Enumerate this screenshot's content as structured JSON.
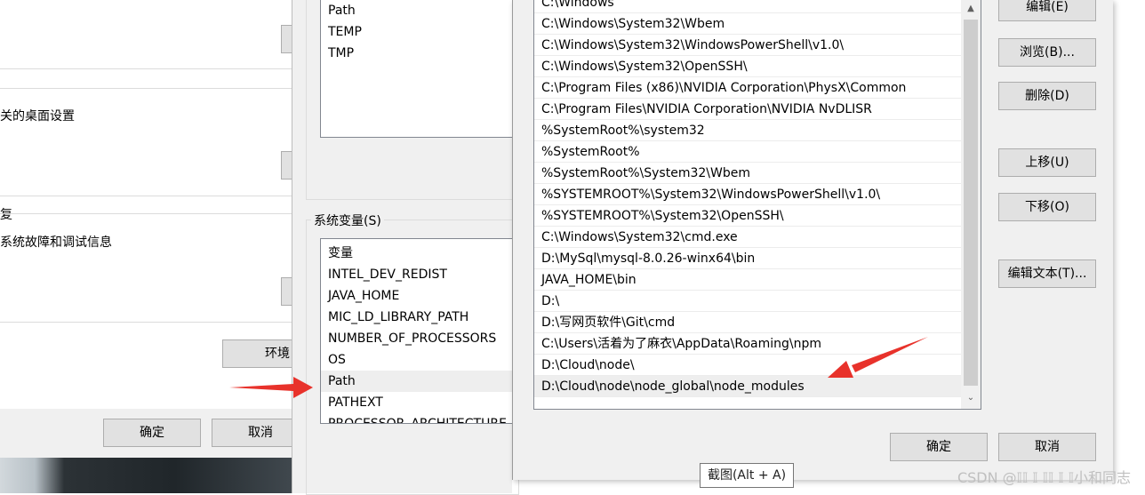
{
  "system_properties": {
    "related_desktop_settings": "关的桌面设置",
    "startup_recovery_heading": "复",
    "startup_recovery_desc": "系统故障和调试信息",
    "env_vars_button": "环境",
    "ok_button": "确定",
    "cancel_button": "取消"
  },
  "environment_variables": {
    "user_vars": [
      "Path",
      "TEMP",
      "TMP"
    ],
    "system_vars_label": "系统变量(S)",
    "system_vars_header": "变量",
    "system_vars": [
      "INTEL_DEV_REDIST",
      "JAVA_HOME",
      "MIC_LD_LIBRARY_PATH",
      "NUMBER_OF_PROCESSORS",
      "OS",
      "Path",
      "PATHEXT",
      "PROCESSOR_ARCHITECTURE"
    ],
    "selected_system_var": "Path"
  },
  "edit_dialog": {
    "path_entries": [
      "C:\\Windows",
      "C:\\Windows\\System32\\Wbem",
      "C:\\Windows\\System32\\WindowsPowerShell\\v1.0\\",
      "C:\\Windows\\System32\\OpenSSH\\",
      "C:\\Program Files (x86)\\NVIDIA Corporation\\PhysX\\Common",
      "C:\\Program Files\\NVIDIA Corporation\\NVIDIA NvDLISR",
      "%SystemRoot%\\system32",
      "%SystemRoot%",
      "%SystemRoot%\\System32\\Wbem",
      "%SYSTEMROOT%\\System32\\WindowsPowerShell\\v1.0\\",
      "%SYSTEMROOT%\\System32\\OpenSSH\\",
      "C:\\Windows\\System32\\cmd.exe",
      "D:\\MySql\\mysql-8.0.26-winx64\\bin",
      "JAVA_HOME\\bin",
      "D:\\",
      "D:\\写网页软件\\Git\\cmd",
      "C:\\Users\\活着为了麻衣\\AppData\\Roaming\\npm",
      "D:\\Cloud\\node\\",
      "D:\\Cloud\\node\\node_global\\node_modules"
    ],
    "selected_entry": "D:\\Cloud\\node\\node_global\\node_modules",
    "buttons": {
      "edit": "编辑(E)",
      "browse": "浏览(B)...",
      "delete": "删除(D)",
      "move_up": "上移(U)",
      "move_down": "下移(O)",
      "edit_text": "编辑文本(T)...",
      "ok": "确定",
      "cancel": "取消"
    }
  },
  "tooltip": "截图(Alt + A)",
  "watermark": "CSDN @𝕀𝕀 𝕀 𝕀𝕀 𝕀 𝕀小和同志",
  "colors": {
    "annotation_arrow": "#e8322b",
    "dialog_bg": "#f0f0f0",
    "button_bg": "#e1e1e1",
    "selected_row": "#eeeeee"
  },
  "icons": {
    "scroll_up": "chevron-up-icon",
    "scroll_down": "chevron-down-icon"
  }
}
